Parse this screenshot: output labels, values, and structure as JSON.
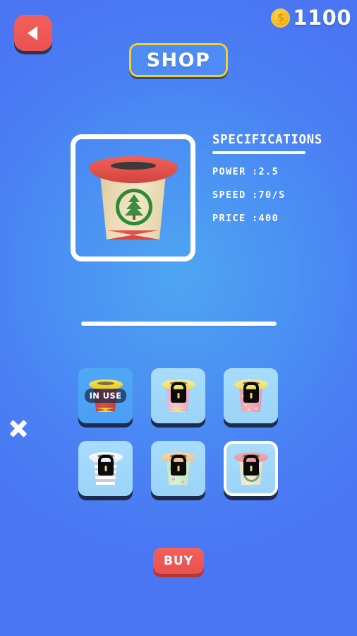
{
  "header": {
    "back_button": "back-arrow",
    "title": "SHOP",
    "coin_symbol": "$",
    "coin_count": "1100"
  },
  "preview": {
    "item_name": "pine-tree-bin",
    "lid_color": "#e2514c",
    "body_color": "#ecdcb6",
    "emblem_color": "#2e8b33"
  },
  "specifications": {
    "heading": "SPECIFICATIONS",
    "rows": [
      {
        "key": "POWER",
        "value": ":2.5"
      },
      {
        "key": "SPEED",
        "value": ":70/S"
      },
      {
        "key": "PRICE",
        "value": ":400"
      }
    ]
  },
  "grid": {
    "prev_arrow": "chevron-left",
    "items": [
      {
        "name": "bin-red-yellow",
        "status": "in-use",
        "badge": "IN USE",
        "selected": false,
        "lid": "#f2d63c",
        "body": "#c9423f",
        "band": "#e8524d",
        "tile": "active"
      },
      {
        "name": "bin-pink-plain",
        "status": "locked",
        "badge": "",
        "selected": false,
        "lid": "#f5e27a",
        "body": "#f0b8cf",
        "band": "#f5e27a",
        "tile": "normal"
      },
      {
        "name": "bin-pink-dots",
        "status": "locked",
        "badge": "",
        "selected": false,
        "lid": "#f5e27a",
        "body": "#f0a8c4",
        "band": "#f0a8c4",
        "tile": "normal"
      },
      {
        "name": "bin-blue-stripes",
        "status": "locked",
        "badge": "",
        "selected": false,
        "lid": "#f2f4f8",
        "body": "#e3e9f5",
        "band": "#c3cfe8",
        "tile": "normal"
      },
      {
        "name": "bin-mint-dots",
        "status": "locked",
        "badge": "",
        "selected": false,
        "lid": "#f3cd9a",
        "body": "#cfeccb",
        "band": "#cfeccb",
        "tile": "normal"
      },
      {
        "name": "bin-pine-tree",
        "status": "locked",
        "badge": "",
        "selected": true,
        "lid": "#efa2a4",
        "body": "#f0e6cf",
        "band": "#f0e6cf",
        "tile": "normal"
      }
    ]
  },
  "footer": {
    "buy_label": "BUY"
  }
}
